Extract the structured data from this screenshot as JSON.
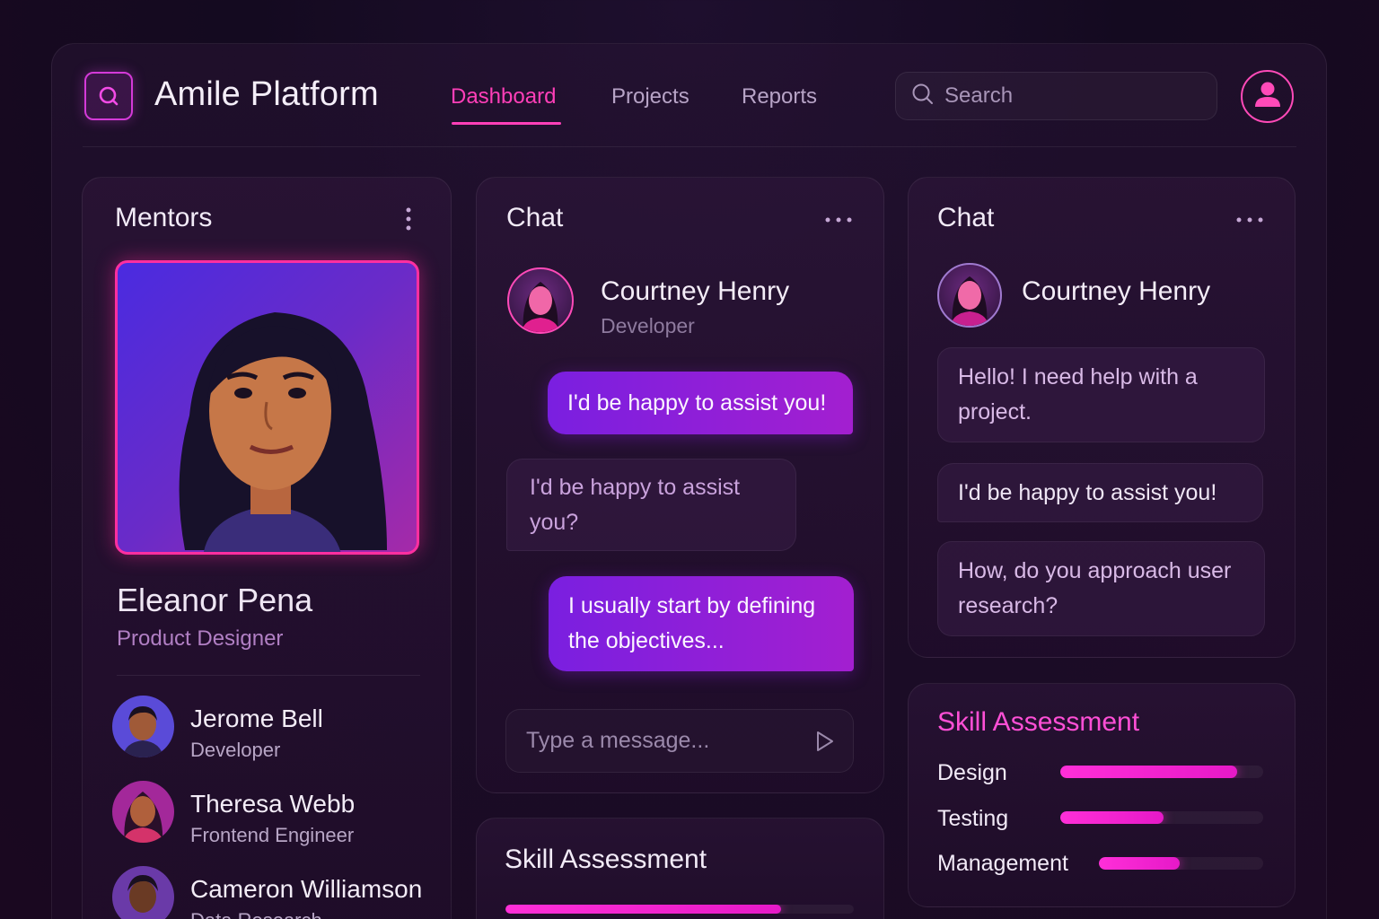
{
  "app": {
    "title": "Amile Platform"
  },
  "nav": {
    "tabs": [
      {
        "label": "Dashboard",
        "active": true
      },
      {
        "label": "Projects"
      },
      {
        "label": "Reports"
      }
    ]
  },
  "search": {
    "placeholder": "Search"
  },
  "colors": {
    "accent": "#ff3fb8",
    "bubble": "#8a1fe0",
    "skill_bar": "#ff2fd8"
  },
  "mentors": {
    "title": "Mentors",
    "featured": {
      "name": "Eleanor Pena",
      "role": "Product Designer"
    },
    "list": [
      {
        "name": "Jerome Bell",
        "role": "Developer"
      },
      {
        "name": "Theresa Webb",
        "role": "Frontend Engineer"
      },
      {
        "name": "Cameron Williamson",
        "role": "Data Research"
      }
    ]
  },
  "chat_main": {
    "title": "Chat",
    "contact": {
      "name": "Courtney Henry",
      "role": "Developer"
    },
    "messages": [
      {
        "direction": "out",
        "text": "I'd be happy to assist you!"
      },
      {
        "direction": "in",
        "text": "I'd be happy to assist you?"
      },
      {
        "direction": "out",
        "text": "I usually start by defining the objectives..."
      }
    ],
    "input_placeholder": "Type a message..."
  },
  "chat_side": {
    "title": "Chat",
    "contact": {
      "name": "Courtney Henry"
    },
    "messages": [
      {
        "text": "Hello! I need help with a project."
      },
      {
        "text": "I'd be happy to assist you!"
      },
      {
        "text": "How, do you approach user research?"
      }
    ]
  },
  "skill_main": {
    "title": "Skill Assessment",
    "progress": 0.79
  },
  "skill_side": {
    "title": "Skill Assessment",
    "skills": [
      {
        "label": "Design",
        "value": 0.87
      },
      {
        "label": "Testing",
        "value": 0.51
      },
      {
        "label": "Management",
        "value": 0.49
      }
    ]
  }
}
